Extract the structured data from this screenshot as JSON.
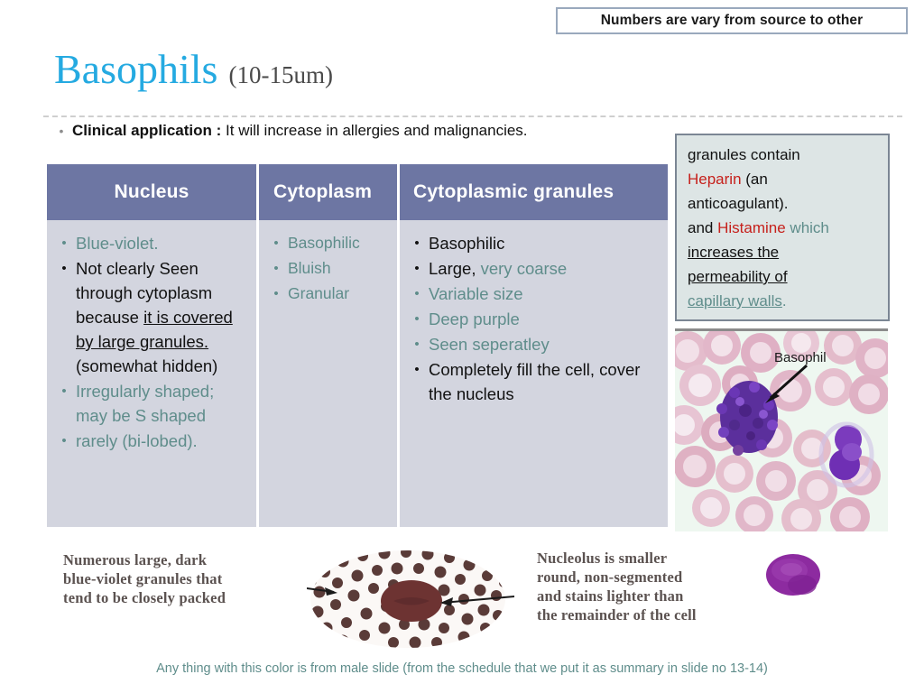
{
  "note": {
    "text": "Numbers are vary from source to other"
  },
  "title": {
    "main": "Basophils",
    "sub": "(10-15um)"
  },
  "clinical": {
    "bullet": "•",
    "label": "Clinical application :",
    "text": " It will increase in allergies and malignancies."
  },
  "table": {
    "columns": [
      {
        "header": "Nucleus",
        "items": [
          {
            "bullet": "•",
            "style": "teal",
            "text": "Blue-violet."
          },
          {
            "bullet": "•",
            "style": "dark",
            "text": " Not clearly Seen through cytoplasm because it is covered by large granules. (somewhat hidden)"
          },
          {
            "bullet": "•",
            "style": "teal",
            "text": "Irregularly shaped; may be S shaped"
          },
          {
            "bullet": "•",
            "style": "teal",
            "text": "rarely (bi-lobed)."
          }
        ]
      },
      {
        "header": "Cytoplasm",
        "items": [
          {
            "bullet": "•",
            "style": "teal",
            "text": "Basophilic"
          },
          {
            "bullet": "•",
            "style": "teal",
            "text": "Bluish"
          },
          {
            "bullet": "•",
            "style": "teal",
            "text": "Granular"
          }
        ]
      },
      {
        "header": "Cytoplasmic granules",
        "items": [
          {
            "bullet": "•",
            "style": "dark",
            "text": "Basophilic"
          },
          {
            "bullet": "•",
            "style": "mixed",
            "text": "Large, very coarse"
          },
          {
            "bullet": "•",
            "style": "teal",
            "text": "Variable size"
          },
          {
            "bullet": "•",
            "style": "teal",
            "text": "Deep purple"
          },
          {
            "bullet": "•",
            "style": "teal",
            "text": "Seen seperatley"
          },
          {
            "bullet": "•",
            "style": "dark",
            "text": "Completely fill the cell, cover the nucleus"
          }
        ]
      }
    ]
  },
  "nucleus_cell": {
    "line1_plain": "Blue-violet.",
    "line2_pre": " Not clearly Seen through cytoplasm because ",
    "line2_underlined": "it is covered by large granules.",
    "line2_post": " (somewhat hidden)",
    "line3": "Irregularly shaped; may be S shaped",
    "line4": "rarely (bi-lobed)."
  },
  "granules_cell": {
    "item2_dark": "Large,",
    "item2_teal": " very coarse"
  },
  "info_box": {
    "l1": "granules contain",
    "l2_red": "Heparin",
    "l2_rest": " (an",
    "l3": "anticoagulant).",
    "l4_pre": "and ",
    "l4_red": "Histamine",
    "l4_post": "  which",
    "l5": "increases the",
    "l6": "permeability of",
    "l7": "capillary walls",
    "l7_end": "."
  },
  "micrograph": {
    "label": "Basophil"
  },
  "diagram": {
    "caption_left": "Numerous large, dark\nblue-violet granules that\ntend to be closely packed",
    "caption_left_lines": [
      "Numerous large, dark",
      "blue-violet granules that",
      "tend to be closely packed"
    ],
    "caption_right_lines": [
      "Nucleolus is smaller",
      "round, non-segmented",
      "and stains lighter than",
      "the remainder of the cell"
    ]
  },
  "footer": {
    "text": "Any thing with this color is from male slide (from the schedule that we put it as summary in slide no 13-14)"
  },
  "colors": {
    "title_blue": "#25aae1",
    "header_slate": "#6d76a3",
    "cell_lavender": "#d3d5df",
    "teal": "#5f8d8b",
    "red": "#c6211c",
    "info_bg": "#dde5e5"
  }
}
